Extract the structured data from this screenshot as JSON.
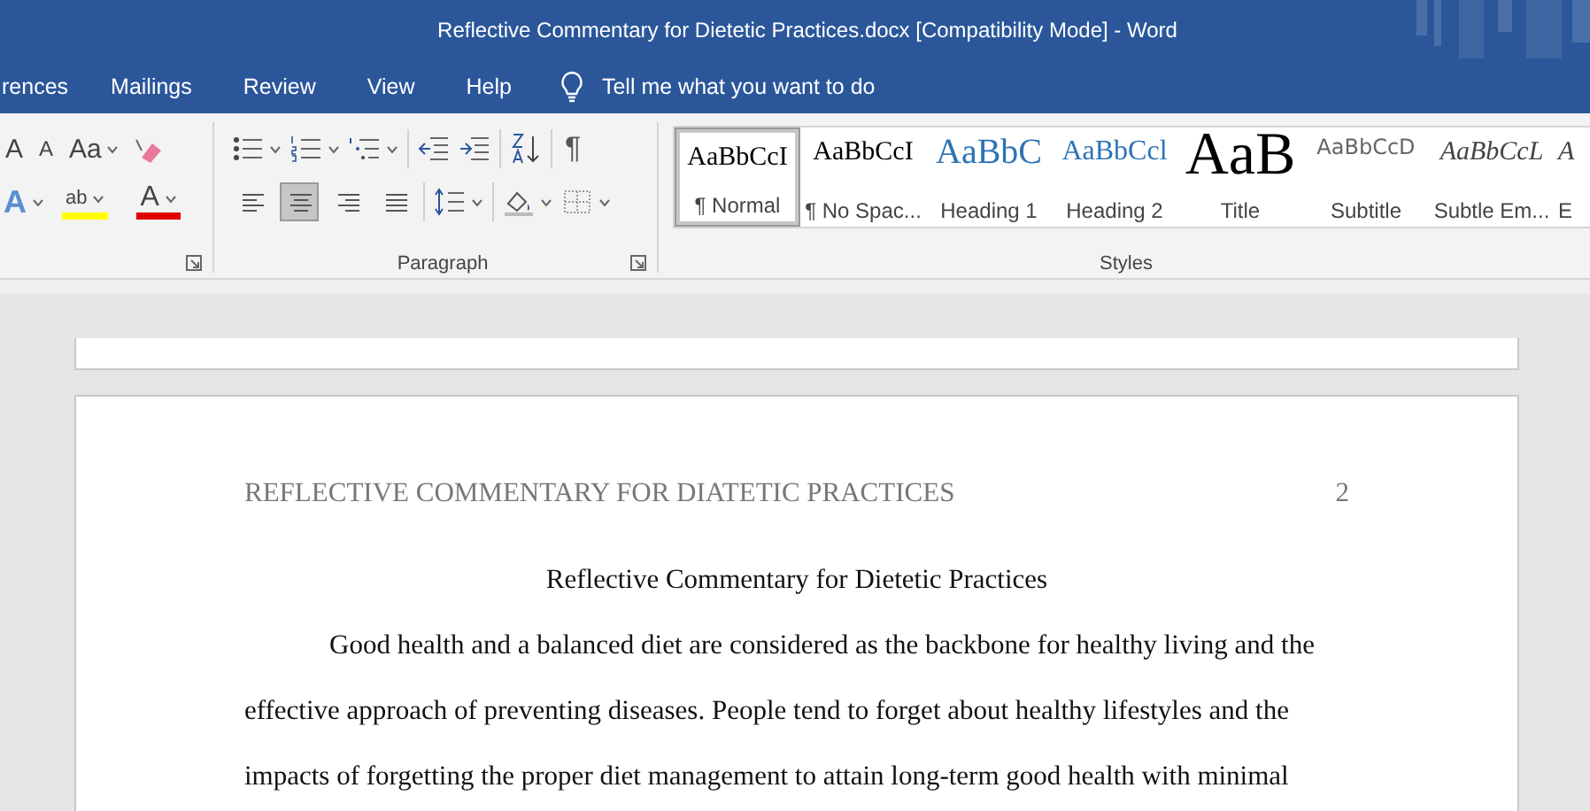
{
  "window": {
    "title": "Reflective Commentary for Dietetic Practices.docx [Compatibility Mode]  -  Word"
  },
  "tabs": [
    {
      "label": "rences",
      "selected": false
    },
    {
      "label": "Mailings",
      "selected": false
    },
    {
      "label": "Review",
      "selected": false
    },
    {
      "label": "View",
      "selected": false
    },
    {
      "label": "Help",
      "selected": false
    }
  ],
  "tell_me": {
    "placeholder": "Tell me what you want to do"
  },
  "font_group": {
    "row1": [
      {
        "kind": "grow",
        "glyph": "A"
      },
      {
        "kind": "shrink",
        "glyph": "A"
      },
      {
        "kind": "case",
        "glyph": "Aa"
      },
      {
        "kind": "clear"
      }
    ],
    "row2": [
      {
        "kind": "effects",
        "glyph": "A"
      },
      {
        "kind": "highlight",
        "glyph": "ab"
      },
      {
        "kind": "color",
        "glyph": "A"
      }
    ]
  },
  "paragraph_group": {
    "label": "Paragraph",
    "pilcrow": "¶",
    "alignment": [
      {
        "kind": "left",
        "selected": false
      },
      {
        "kind": "center",
        "selected": true
      },
      {
        "kind": "right",
        "selected": false
      },
      {
        "kind": "justify",
        "selected": false
      }
    ]
  },
  "styles_group": {
    "label": "Styles",
    "items": [
      {
        "kind": "normal",
        "preview": "AaBbCcI",
        "name": "¶ Normal",
        "selected": true
      },
      {
        "kind": "nospacing",
        "preview": "AaBbCcI",
        "name": "¶ No Spac...",
        "selected": false
      },
      {
        "kind": "heading1",
        "preview": "AaBbC",
        "name": "Heading 1",
        "selected": false
      },
      {
        "kind": "heading2",
        "preview": "AaBbCcl",
        "name": "Heading 2",
        "selected": false
      },
      {
        "kind": "title",
        "preview": "AaB",
        "name": "Title",
        "selected": false
      },
      {
        "kind": "subtitle",
        "preview": "AaBbCcD",
        "name": "Subtitle",
        "selected": false
      },
      {
        "kind": "subtle",
        "preview": "AaBbCcL",
        "name": "Subtle Em...",
        "selected": false
      },
      {
        "kind": "emphasis",
        "preview": "A",
        "name": "E",
        "selected": false
      }
    ]
  },
  "document": {
    "header": "REFLECTIVE COMMENTARY FOR DIATETIC PRACTICES",
    "page_number": "2",
    "title": "Reflective Commentary for Dietetic Practices",
    "paragraph": "Good health and a balanced diet are considered as the backbone for healthy living and the effective approach of preventing diseases. People tend to forget about healthy lifestyles and the impacts of forgetting the proper diet management to attain long-term good health with minimal"
  }
}
